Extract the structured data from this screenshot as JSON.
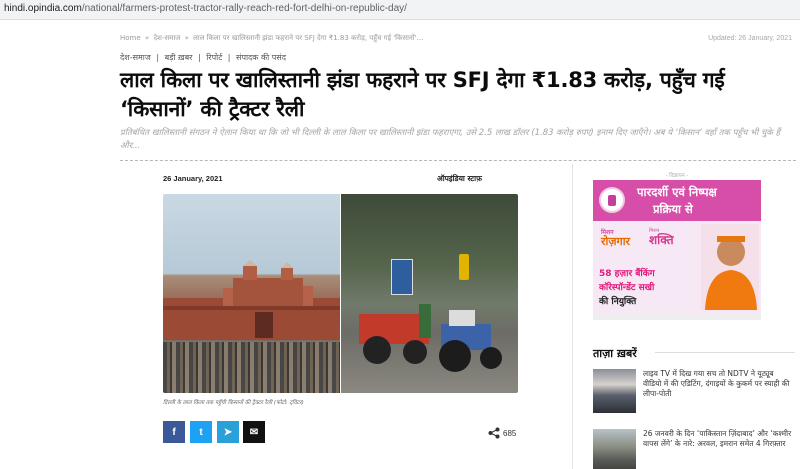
{
  "browser": {
    "url_host": "hindi.opindia.com",
    "url_path": "/national/farmers-protest-tractor-rally-reach-red-fort-delhi-on-republic-day/"
  },
  "breadcrumb": {
    "home": "Home",
    "sep": "»",
    "section": "देश-समाज",
    "current": "लाल किला पर खालिस्तानी झंडा फहराने पर SFJ देगा ₹1.83 करोड़, पहुँच गई 'किसानों'..."
  },
  "updated": "Updated: 26 January, 2021",
  "categories": [
    "देश-समाज",
    "बड़ी ख़बर",
    "रिपोर्ट",
    "संपादक की पसंद"
  ],
  "category_sep": "|",
  "headline": "लाल किला पर खालिस्तानी झंडा फहराने पर SFJ देगा ₹1.83 करोड़, पहुँच गई ‘किसानों’ की ट्रैक्टर रैली",
  "dek": "प्रतिबंधित खालिस्तानी संगठन ने ऐलान किया था कि जो भी दिल्ली के लाल किला पर खालिस्तानी झंडा फहराएगा, उसे 2.5 लाख डॉलर (1.83 करोड़ रुपए) इनाम दिए जाएँगे। अब ये ‘किसान’ वहाँ तक पहुँच भी चुके हैं और...",
  "article": {
    "date": "26 January, 2021",
    "author": "ऑपइंडिया स्टाफ़",
    "caption": "दिल्ली के लाल किला तक पहुँची किसानों की ट्रैक्टर रैली (फोटो: ट्विटर)"
  },
  "share": {
    "facebook_icon": "f",
    "twitter_icon": "t",
    "telegram_icon": "➤",
    "email_icon": "✉",
    "count": "685"
  },
  "ad": {
    "label": "- विज्ञापन -",
    "head_line1": "पारदर्शी एवं निष्पक्ष",
    "head_line2": "प्रक्रिया से",
    "mission_small": "मिशन",
    "mission_big": "रोज़गार",
    "shakti_small": "मिशन",
    "shakti_big": "शक्ति",
    "line1": "58 हज़ार बैंकिंग",
    "line2": "कॉरेस्पॉन्डेंट सखी",
    "line3": "की नियुक्ति",
    "footer": "",
    "brand_color": "#d74ea9"
  },
  "latest": {
    "title": "ताज़ा ख़बरें",
    "items": [
      {
        "text": "लाइव TV में दिख गया सच तो NDTV ने यूट्यूब वीडियो में की एडिटिंग, दंगाइयों के कुकर्म पर स्याही की लीपा-पोती"
      },
      {
        "text": "26 जनवरी के दिन ‘पाकिस्तान ज़िंदाबाद’ और ‘कश्मीर वापस लेंगे’ के नारे: अरवल, इमरान समेत 4 गिरफ़्तार"
      }
    ]
  }
}
